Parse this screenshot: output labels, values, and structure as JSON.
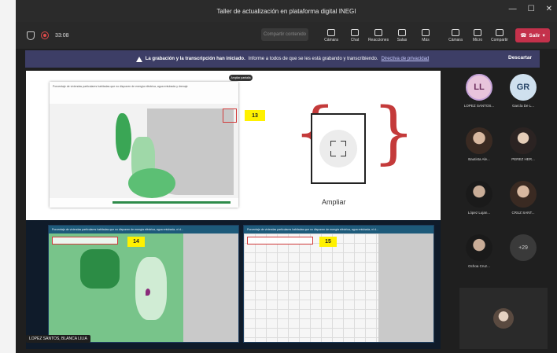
{
  "window": {
    "title": "Taller de actualización en plataforma digital INEGI",
    "controls": [
      "—",
      "☐",
      "✕"
    ]
  },
  "toolbar": {
    "timer": "33:08",
    "share_label": "Compartir contenido",
    "icons": [
      {
        "name": "camera-icon",
        "label": "Cámara"
      },
      {
        "name": "chat-icon",
        "label": "Chat"
      },
      {
        "name": "reactions-icon",
        "label": "Reacciones"
      },
      {
        "name": "rooms-icon",
        "label": "Salas"
      },
      {
        "name": "more-icon",
        "label": "Más"
      }
    ],
    "icons2": [
      {
        "name": "video-icon",
        "label": "Cámara"
      },
      {
        "name": "mic-icon",
        "label": "Micro"
      },
      {
        "name": "share-icon",
        "label": "Compartir"
      }
    ],
    "leave_label": "Salir"
  },
  "banner": {
    "bold": "La grabación y la transcripción han iniciado.",
    "text": "Informe a todos de que se les está grabando y transcribiendo.",
    "link": "Directiva de privacidad",
    "dismiss": "Descartar"
  },
  "slide": {
    "map_title": "Porcentaje de viviendas particulares habitadas que no disponen de energía eléctrica, agua entubada y drenaje",
    "expand_tip": "Ampliar pantalla",
    "label13": "13",
    "ampliar": "Ampliar",
    "panel14_title": "Porcentaje de viviendas particulares habitadas que no disponen de energía eléctrica, agua entubada, ni d...",
    "panel15_title": "Porcentaje de viviendas particulares habitadas que no disponen de energía eléctrica, agua entubada, ni d...",
    "label14": "14",
    "label15": "15"
  },
  "presenter": "LOPEZ SANTOS, BLANCA LILIA",
  "participants": [
    {
      "initials": "LL",
      "name": "LOPEZ SANTOS...",
      "type": "init"
    },
    {
      "initials": "GR",
      "name": "García De L...",
      "type": "init2"
    },
    {
      "initials": "",
      "name": "Bautista Ale...",
      "type": "photo"
    },
    {
      "initials": "",
      "name": "PEREZ HER...",
      "type": "photo2"
    },
    {
      "initials": "",
      "name": "López Lujan...",
      "type": "photo3"
    },
    {
      "initials": "",
      "name": "CRUZ SANT...",
      "type": "photo"
    },
    {
      "initials": "",
      "name": "Ochoa Cruz...",
      "type": "photo3"
    },
    {
      "initials": "+29",
      "name": "",
      "type": "more"
    }
  ]
}
